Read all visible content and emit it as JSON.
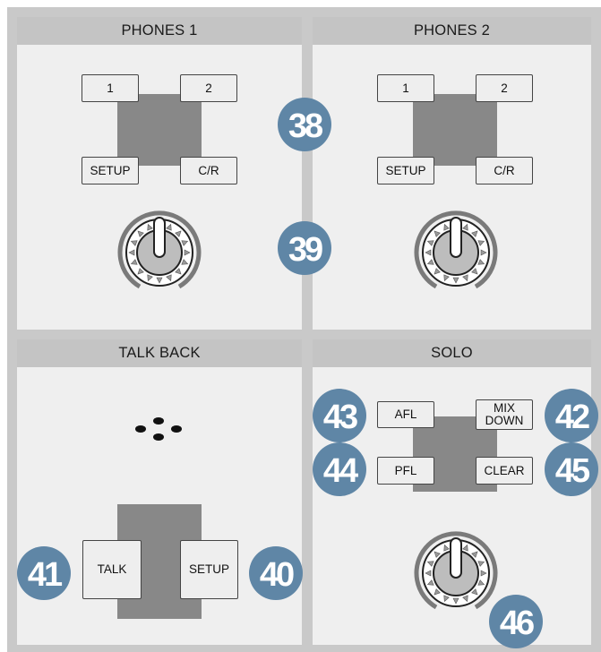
{
  "panels": {
    "phones1": {
      "title": "PHONES 1",
      "buttons": {
        "b1": "1",
        "b2": "2",
        "setup": "SETUP",
        "cr": "C/R"
      }
    },
    "phones2": {
      "title": "PHONES 2",
      "buttons": {
        "b1": "1",
        "b2": "2",
        "setup": "SETUP",
        "cr": "C/R"
      }
    },
    "talkback": {
      "title": "TALK BACK",
      "buttons": {
        "talk": "TALK",
        "setup": "SETUP"
      }
    },
    "solo": {
      "title": "SOLO",
      "buttons": {
        "afl": "AFL",
        "mixdown": "MIX DOWN",
        "pfl": "PFL",
        "clear": "CLEAR"
      }
    }
  },
  "callouts": {
    "c38": "38",
    "c39": "39",
    "c40": "40",
    "c41": "41",
    "c42": "42",
    "c43": "43",
    "c44": "44",
    "c45": "45",
    "c46": "46"
  },
  "colors": {
    "panel_bg": "#efefef",
    "header_bg": "#c4c4c4",
    "frame_bg": "#c9c9c9",
    "button_group_bg": "#888888",
    "callout_fill": "#5f86a6",
    "callout_text": "#ffffff"
  }
}
